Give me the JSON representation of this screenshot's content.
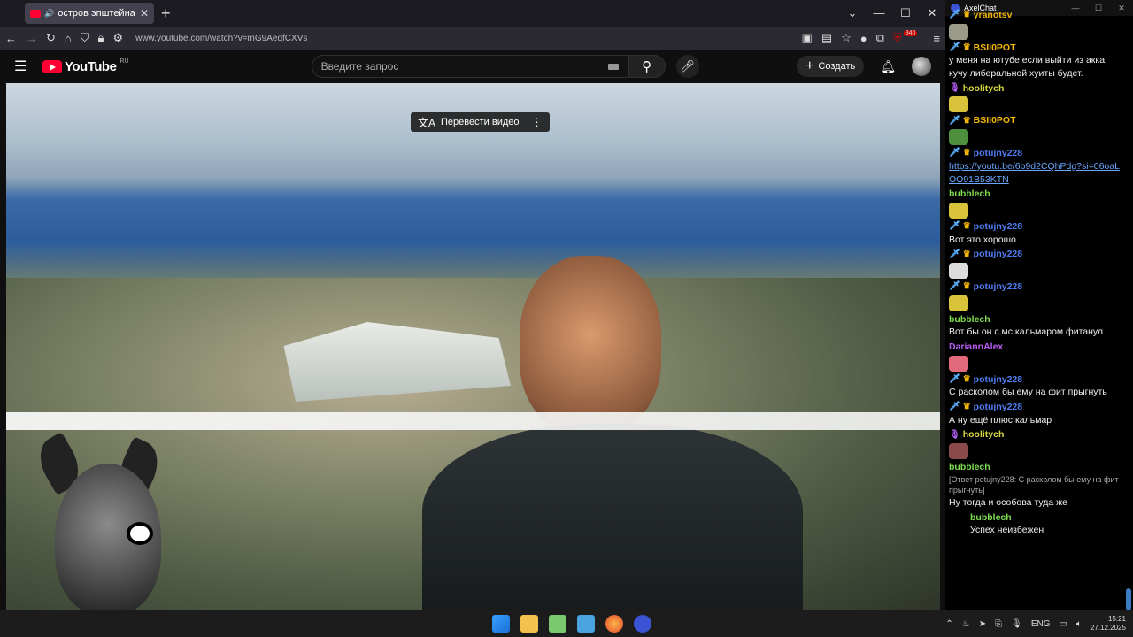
{
  "browser": {
    "tab_title": "остров эпштейна - YouTube",
    "new_tab": "+",
    "url": "www.youtube.com/watch?v=mG9AeqfCXVs",
    "extension_badge": "340",
    "win_min": "—",
    "win_max": "☐",
    "win_close": "✕"
  },
  "youtube": {
    "logo_text": "YouTube",
    "region": "RU",
    "search_placeholder": "Введите запрос",
    "create_label": "Создать"
  },
  "video": {
    "translate_label": "Перевести видео"
  },
  "chat": {
    "app_title": "AxelChat",
    "messages": [
      {
        "user": "yranotsv",
        "color": "#f2b60a",
        "badges": [
          "sword",
          "crown"
        ]
      },
      {
        "emote": true,
        "color": "#9a9a88"
      },
      {
        "user": "BSII0POT",
        "color": "#f2b60a",
        "badges": [
          "sword",
          "crown"
        ],
        "text": "у меня на ютубе если выйти из акка кучу либеральной хуиты будет."
      },
      {
        "user": "hoolitych",
        "color": "#d9d93d",
        "badges": [
          "mic"
        ]
      },
      {
        "emote": true,
        "color": "#d9c33a"
      },
      {
        "user": "BSII0POT",
        "color": "#f2b60a",
        "badges": [
          "sword",
          "crown"
        ]
      },
      {
        "emote": true,
        "color": "#4d8f3d"
      },
      {
        "user": "potujny228",
        "color": "#4f7df3",
        "badges": [
          "sword",
          "crown"
        ],
        "link": "https://youtu.be/6b9d2CQhPdg?si=06oaLOO91B53KTN"
      },
      {
        "user": "bubblech",
        "color": "#7ddc4f",
        "badges": []
      },
      {
        "emote": true,
        "color": "#d9c33a"
      },
      {
        "user": "potujny228",
        "color": "#4f7df3",
        "badges": [
          "sword",
          "crown"
        ],
        "text": "Вот это хорошо"
      },
      {
        "user": "potujny228",
        "color": "#4f7df3",
        "badges": [
          "sword",
          "crown"
        ]
      },
      {
        "emote": true,
        "color": "#dddddd"
      },
      {
        "user": "potujny228",
        "color": "#4f7df3",
        "badges": [
          "sword",
          "crown"
        ]
      },
      {
        "emote": true,
        "color": "#d9c33a"
      },
      {
        "user": "bubblech",
        "color": "#7ddc4f",
        "badges": [],
        "text": "Вот бы он с мс кальмаром фитанул"
      },
      {
        "user": "DariannAlex",
        "color": "#b75cf0",
        "badges": []
      },
      {
        "emote": true,
        "color": "#e06a7a"
      },
      {
        "user": "potujny228",
        "color": "#4f7df3",
        "badges": [
          "sword",
          "crown"
        ],
        "text": "С расколом бы ему на фит прыгнуть"
      },
      {
        "user": "potujny228",
        "color": "#4f7df3",
        "badges": [
          "sword",
          "crown"
        ],
        "text": "А ну ещё плюс кальмар"
      },
      {
        "user": "hoolitych",
        "color": "#d9d93d",
        "badges": [
          "mic"
        ]
      },
      {
        "emote": true,
        "color": "#8a4a4a"
      },
      {
        "user": "bubblech",
        "color": "#7ddc4f",
        "badges": [],
        "reply": "[Ответ potujny228: С расколом бы ему на фит прыгнуть]",
        "text": "Ну тогда и особова туда же"
      },
      {
        "user": "bubblech",
        "color": "#7ddc4f",
        "badges": [],
        "indent": true,
        "text": "Успех неизбежен"
      }
    ]
  },
  "taskbar": {
    "time": "15:21",
    "date": "27.12.2025",
    "lang": "ENG"
  }
}
